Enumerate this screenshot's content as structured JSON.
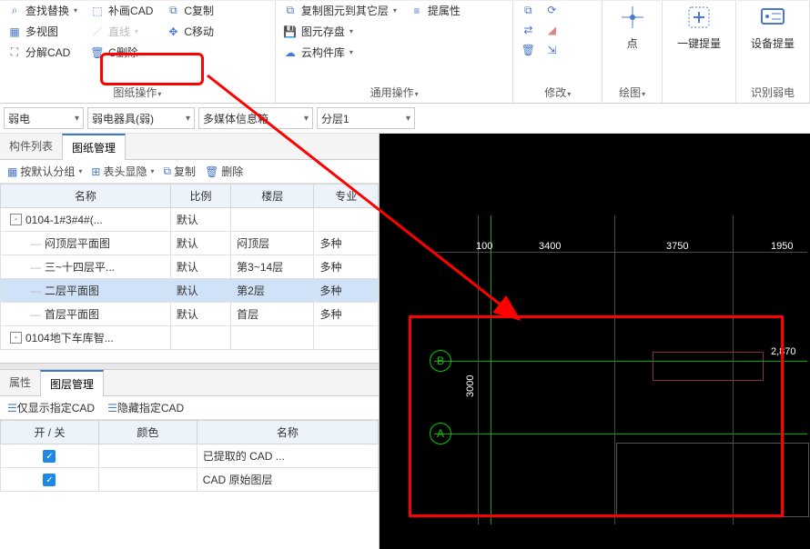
{
  "ribbon": {
    "g1": {
      "label": "图纸操作",
      "cmds": {
        "find": "查找替换",
        "multi": "多视图",
        "decomp": "分解CAD",
        "fillcad": "补画CAD",
        "line": "直线",
        "cdel": "C删除",
        "ccopy": "C复制",
        "cmove": "C移动"
      }
    },
    "g2": {
      "label": "通用操作",
      "cmds": {
        "copyto": "复制图元到其它层",
        "save": "图元存盘",
        "cloud": "云构件库",
        "prop": "提属性"
      }
    },
    "g3": {
      "label": "修改",
      "icons": {
        "a": "复制",
        "b": "镜像",
        "c": "旋转",
        "d": "拉伸",
        "e": "删除",
        "f": "对齐"
      }
    },
    "g4": {
      "label": "点"
    },
    "g5": {
      "label": "绘图"
    },
    "g6": {
      "label": "一键提量"
    },
    "g7": {
      "label": "设备提量"
    },
    "g8": {
      "label": "识别弱电"
    }
  },
  "selectors": {
    "s1": "弱电",
    "s2": "弱电器具(弱)",
    "s3": "多媒体信息箱",
    "s4": "分层1"
  },
  "panelTabs": {
    "t1": "构件列表",
    "t2": "图纸管理"
  },
  "toolbar2": {
    "group": "按默认分组",
    "header": "表头显隐",
    "copy": "复制",
    "del": "删除"
  },
  "gridHeaders": {
    "name": "名称",
    "scale": "比例",
    "floor": "楼层",
    "spec": "专业"
  },
  "rows": [
    {
      "name": "0104-1#3#4#(...",
      "scale": "默认",
      "floor": "",
      "spec": "",
      "lvl": 0,
      "exp": "-"
    },
    {
      "name": "闷顶层平面图",
      "scale": "默认",
      "floor": "闷顶层",
      "spec": "多种",
      "lvl": 1
    },
    {
      "name": "三~十四层平...",
      "scale": "默认",
      "floor": "第3~14层",
      "spec": "多种",
      "lvl": 1
    },
    {
      "name": "二层平面图",
      "scale": "默认",
      "floor": "第2层",
      "spec": "多种",
      "lvl": 1,
      "sel": true
    },
    {
      "name": "首层平面图",
      "scale": "默认",
      "floor": "首层",
      "spec": "多种",
      "lvl": 1
    },
    {
      "name": "0104地下车库智...",
      "scale": "",
      "floor": "",
      "spec": "",
      "lvl": 0,
      "exp": "-"
    }
  ],
  "lowerTabs": {
    "t1": "属性",
    "t2": "图层管理"
  },
  "layerTools": {
    "show": "仅显示指定CAD",
    "hide": "隐藏指定CAD"
  },
  "layerHeaders": {
    "onoff": "开 / 关",
    "color": "颜色",
    "name": "名称"
  },
  "layerRows": [
    {
      "name": "已提取的 CAD ..."
    },
    {
      "name": "CAD 原始图层"
    }
  ],
  "canvas": {
    "dimA": "100",
    "dimB": "3400",
    "dimC": "3750",
    "dimD": "1950",
    "v3000": "3000",
    "v2870": "2,870",
    "bubA": "A",
    "bubB": "B",
    "axisnums": [
      "100",
      "100"
    ]
  }
}
